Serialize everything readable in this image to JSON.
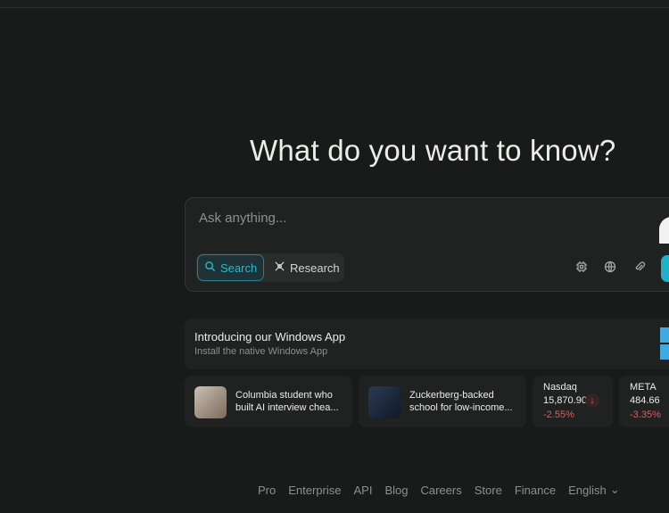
{
  "headline": "What do you want to know?",
  "composer": {
    "placeholder": "Ask anything...",
    "modes": {
      "search": "Search",
      "research": "Research"
    },
    "tools": [
      "chip-icon",
      "globe-icon",
      "paperclip-icon"
    ],
    "accent": "#1fb2c6"
  },
  "promo": {
    "title": "Introducing our Windows App",
    "subtitle": "Install the native Windows App"
  },
  "news": [
    {
      "title": "Columbia student who built AI interview chea..."
    },
    {
      "title": "Zuckerberg-backed school for low-income..."
    }
  ],
  "stocks": [
    {
      "symbol": "Nasdaq",
      "price": "15,870.90",
      "change": "-2.55%"
    },
    {
      "symbol": "META",
      "price": "484.66",
      "change": "-3.35%"
    }
  ],
  "footer": {
    "links": [
      "Pro",
      "Enterprise",
      "API",
      "Blog",
      "Careers",
      "Store",
      "Finance"
    ],
    "language": "English"
  }
}
